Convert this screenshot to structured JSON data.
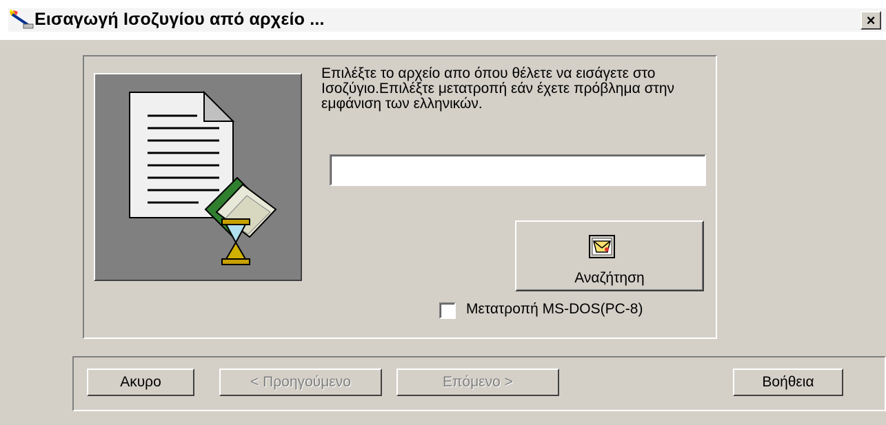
{
  "window": {
    "title": "Εισαγωγή Ισοζυγίου από αρχείο ...",
    "close_label": "×"
  },
  "main": {
    "instructions": "Επιλέξτε το αρχείο απο όπου θέλετε να εισάγετε στο Ισοζύγιο.Επιλέξτε μετατροπή εάν έχετε πρόβλημα στην εμφάνιση των ελληνικών.",
    "file_path": {
      "value": "",
      "placeholder": ""
    },
    "search_button_label": "Αναζήτηση",
    "convert_checkbox": {
      "label": "Μετατροπή MS-DOS(PC-8)",
      "checked": false
    }
  },
  "footer": {
    "cancel_label": "Ακυρο",
    "previous_label": "< Προηγούμενο",
    "next_label": "Επόμενο >",
    "help_label": "Βοήθεια"
  },
  "icons": {
    "app": "wand-icon",
    "illustration": "document-hourglass-icon",
    "search": "search-icon",
    "close": "close-icon"
  },
  "colors": {
    "face": "#d4d0c8",
    "panel": "#808080",
    "disabled_text": "#808080"
  }
}
